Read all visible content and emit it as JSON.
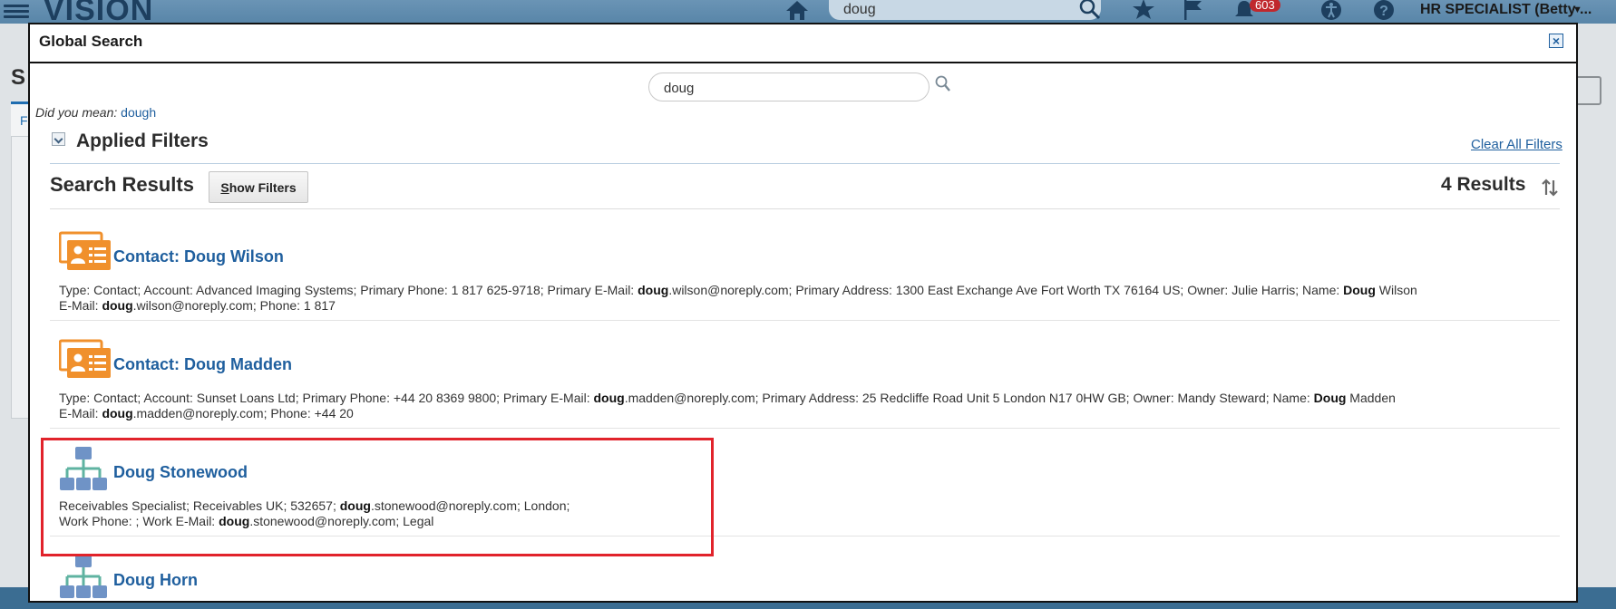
{
  "app": {
    "brand": "VISION",
    "header_search_value": "doug",
    "notification_count": "603",
    "user_label": "HR SPECIALIST (Betty ..."
  },
  "dialog": {
    "title": "Global Search",
    "search_value": "doug",
    "did_you_mean_label": "Did you mean:",
    "did_you_mean_suggestion": "dough",
    "applied_filters_label": "Applied Filters",
    "clear_all_filters_label": "Clear All Filters",
    "search_results_label": "Search Results",
    "show_filters_label": "Show Filters",
    "results_count": "4 Results"
  },
  "results": [
    {
      "icon": "contact-card-icon",
      "title": "Contact: Doug Wilson",
      "line1": [
        {
          "t": "Type: Contact; Account: Advanced Imaging Systems; Primary Phone: 1 817 625-9718; Primary E-Mail: "
        },
        {
          "t": "doug",
          "b": true
        },
        {
          "t": ".wilson@noreply.com; Primary Address: 1300 East Exchange Ave Fort Worth TX 76164 US; Owner: Julie Harris; Name: "
        },
        {
          "t": "Doug",
          "b": true
        },
        {
          "t": " Wilson"
        }
      ],
      "line2": [
        {
          "t": "E-Mail: "
        },
        {
          "t": "doug",
          "b": true
        },
        {
          "t": ".wilson@noreply.com; Phone: 1 817"
        }
      ]
    },
    {
      "icon": "contact-card-icon",
      "title": "Contact: Doug Madden",
      "line1": [
        {
          "t": "Type: Contact; Account: Sunset Loans Ltd; Primary Phone: +44 20 8369 9800; Primary E-Mail: "
        },
        {
          "t": "doug",
          "b": true
        },
        {
          "t": ".madden@noreply.com; Primary Address: 25 Redcliffe Road Unit 5 London N17 0HW GB; Owner: Mandy Steward; Name: "
        },
        {
          "t": "Doug",
          "b": true
        },
        {
          "t": " Madden"
        }
      ],
      "line2": [
        {
          "t": "E-Mail: "
        },
        {
          "t": "doug",
          "b": true
        },
        {
          "t": ".madden@noreply.com; Phone: +44 20"
        }
      ]
    },
    {
      "icon": "org-chart-icon",
      "title": "Doug Stonewood",
      "line1": [
        {
          "t": "Receivables Specialist; Receivables UK; 532657; "
        },
        {
          "t": "doug",
          "b": true
        },
        {
          "t": ".stonewood@noreply.com; London;"
        }
      ],
      "line2": [
        {
          "t": "Work Phone: ; Work E-Mail: "
        },
        {
          "t": "doug",
          "b": true
        },
        {
          "t": ".stonewood@noreply.com; Legal"
        }
      ]
    },
    {
      "icon": "org-chart-icon",
      "title": "Doug Horn",
      "line1": [],
      "line2": []
    }
  ],
  "colors": {
    "accent_link": "#1f5f9e",
    "highlight_border": "#e1232b",
    "contact_icon": "#f0902c",
    "org_icon_box": "#6f93c6",
    "org_icon_line": "#5fb3a1"
  }
}
